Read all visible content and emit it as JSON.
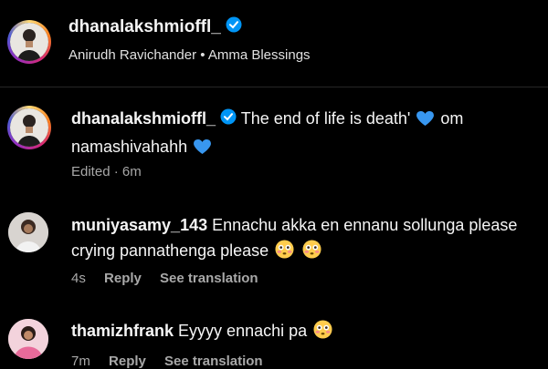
{
  "post": {
    "username": "dhanalakshmioffl_",
    "subtitle": "Anirudh Ravichander • Amma Blessings"
  },
  "caption": {
    "username": "dhanalakshmioffl_",
    "text_line1": "The end of life is death'",
    "text_line1_tail": "om",
    "text_line2": "namashivahahh",
    "status": "Edited · 6m"
  },
  "comments": [
    {
      "username": "muniyasamy_143",
      "text_line1": "Ennachu akka en ennanu sollunga please",
      "text_line2": "crying pannathenga please",
      "time": "4s",
      "reply_label": "Reply",
      "translate_label": "See translation"
    },
    {
      "username": "thamizhfrank",
      "text_line1": "Eyyyy ennachi pa",
      "time": "7m",
      "reply_label": "Reply",
      "translate_label": "See translation"
    }
  ],
  "colors": {
    "background": "#000000",
    "verified": "#0095f6",
    "secondary_text": "#a8a8a8",
    "heart": "#3897f0"
  },
  "icons": [
    "verified-badge-icon",
    "blue-heart-icon",
    "flushed-face-emoji"
  ]
}
